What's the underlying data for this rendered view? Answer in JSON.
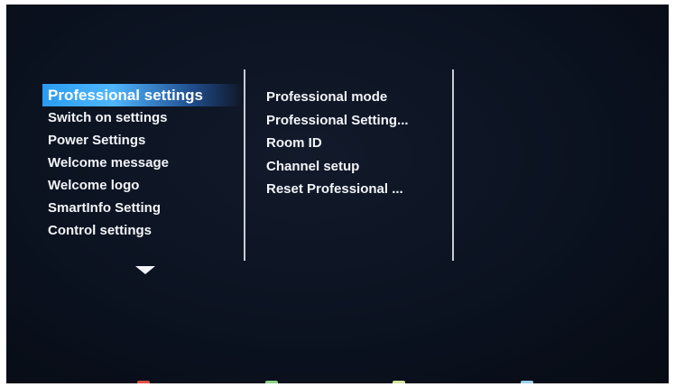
{
  "main_menu": {
    "items": [
      {
        "label": "Professional settings",
        "selected": true
      },
      {
        "label": "Switch on settings"
      },
      {
        "label": "Power Settings"
      },
      {
        "label": "Welcome message"
      },
      {
        "label": "Welcome logo"
      },
      {
        "label": "SmartInfo Setting"
      },
      {
        "label": "Control settings"
      }
    ],
    "scroll_indicator": "chevron-down-icon"
  },
  "sub_menu": {
    "items": [
      {
        "label": "Professional mode"
      },
      {
        "label": "Professional Setting..."
      },
      {
        "label": "Room ID"
      },
      {
        "label": "Channel setup"
      },
      {
        "label": "Reset Professional ..."
      }
    ]
  },
  "colors": {
    "selection": "#2a9cf0",
    "background": "#0b1220",
    "text": "#f2f4f8",
    "key_red": "#e0504a",
    "key_green": "#8fd08a",
    "key_yellow": "#d8e3a0",
    "key_blue": "#9fd0f0"
  },
  "color_keys": [
    "red-key-icon",
    "green-key-icon",
    "yellow-key-icon",
    "blue-key-icon"
  ]
}
